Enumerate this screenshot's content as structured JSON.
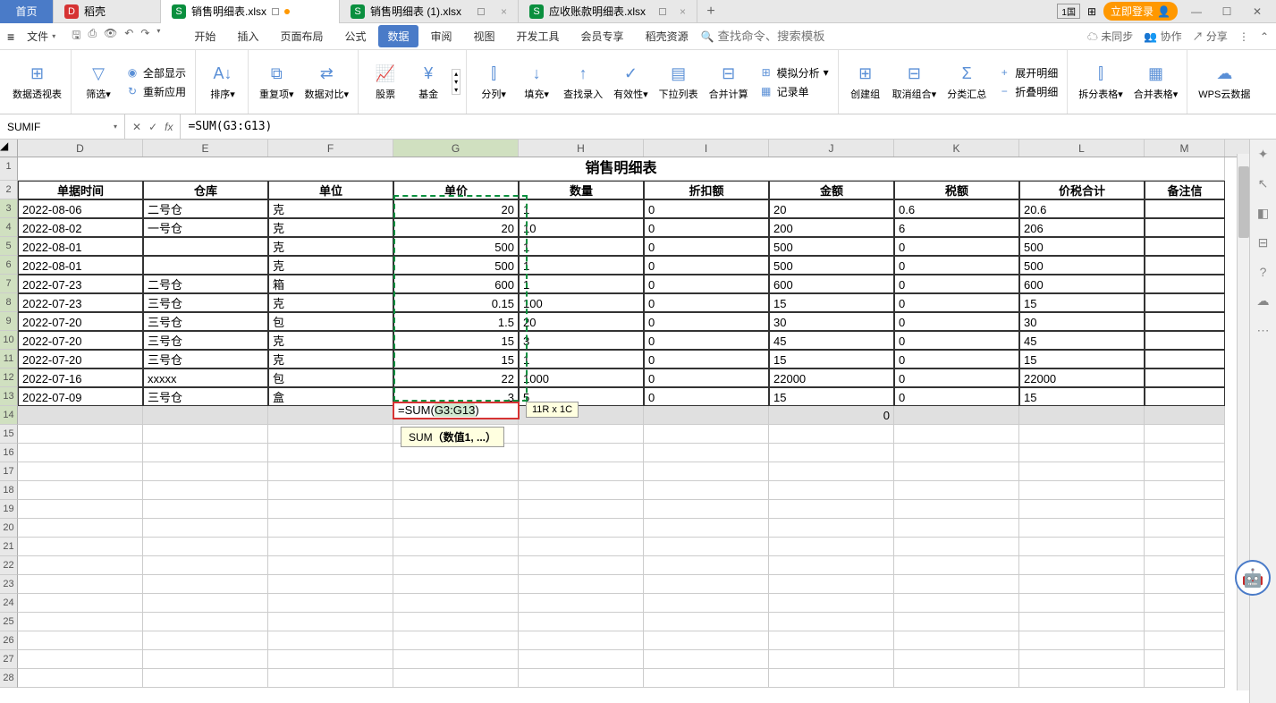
{
  "tabs": {
    "home": "首页",
    "docer": "稻壳",
    "active": "销售明细表.xlsx",
    "t2": "销售明细表 (1).xlsx",
    "t3": "应收账款明细表.xlsx"
  },
  "titlebar": {
    "login": "立即登录",
    "lang": "1国"
  },
  "menu": {
    "file": "文件",
    "items": [
      "开始",
      "插入",
      "页面布局",
      "公式",
      "数据",
      "审阅",
      "视图",
      "开发工具",
      "会员专享",
      "稻壳资源"
    ],
    "active_index": 4,
    "search_placeholder": "查找命令、搜索模板",
    "unsync": "未同步",
    "coop": "协作",
    "share": "分享"
  },
  "ribbon": {
    "pivot": "数据透视表",
    "filter": "筛选",
    "show_all": "全部显示",
    "reapply": "重新应用",
    "sort": "排序",
    "dup": "重复项",
    "compare": "数据对比",
    "stock": "股票",
    "fund": "基金",
    "split": "分列",
    "fill": "填充",
    "lookup": "查找录入",
    "valid": "有效性",
    "dropdown": "下拉列表",
    "consolidate": "合并计算",
    "whatif": "模拟分析",
    "form": "记录单",
    "group": "创建组",
    "ungroup": "取消组合",
    "subtotal": "分类汇总",
    "expand": "展开明细",
    "collapse": "折叠明细",
    "splittbl": "拆分表格",
    "mergetbl": "合并表格",
    "wps": "WPS云数据"
  },
  "formula_bar": {
    "name_box": "SUMIF",
    "formula": "=SUM(G3:G13)"
  },
  "sheet": {
    "title": "销售明细表",
    "headers": {
      "D": "单据时间",
      "E": "仓库",
      "F": "单位",
      "G": "单价",
      "H": "数量",
      "I": "折扣额",
      "J": "金额",
      "K": "税额",
      "L": "价税合计",
      "M": "备注信"
    },
    "rows": [
      {
        "D": "2022-08-06",
        "E": "二号仓",
        "F": "克",
        "G": "20",
        "H": "1",
        "I": "0",
        "J": "20",
        "K": "0.6",
        "L": "20.6"
      },
      {
        "D": "2022-08-02",
        "E": "一号仓",
        "F": "克",
        "G": "20",
        "H": "10",
        "I": "0",
        "J": "200",
        "K": "6",
        "L": "206"
      },
      {
        "D": "2022-08-01",
        "E": "",
        "F": "克",
        "G": "500",
        "H": "1",
        "I": "0",
        "J": "500",
        "K": "0",
        "L": "500"
      },
      {
        "D": "2022-08-01",
        "E": "",
        "F": "克",
        "G": "500",
        "H": "1",
        "I": "0",
        "J": "500",
        "K": "0",
        "L": "500"
      },
      {
        "D": "2022-07-23",
        "E": "二号仓",
        "F": "箱",
        "G": "600",
        "H": "1",
        "I": "0",
        "J": "600",
        "K": "0",
        "L": "600"
      },
      {
        "D": "2022-07-23",
        "E": "三号仓",
        "F": "克",
        "G": "0.15",
        "H": "100",
        "I": "0",
        "J": "15",
        "K": "0",
        "L": "15"
      },
      {
        "D": "2022-07-20",
        "E": "三号仓",
        "F": "包",
        "G": "1.5",
        "H": "20",
        "I": "0",
        "J": "30",
        "K": "0",
        "L": "30"
      },
      {
        "D": "2022-07-20",
        "E": "三号仓",
        "F": "克",
        "G": "15",
        "H": "3",
        "I": "0",
        "J": "45",
        "K": "0",
        "L": "45"
      },
      {
        "D": "2022-07-20",
        "E": "三号仓",
        "F": "克",
        "G": "15",
        "H": "1",
        "I": "0",
        "J": "15",
        "K": "0",
        "L": "15"
      },
      {
        "D": "2022-07-16",
        "E": "xxxxx",
        "F": "包",
        "G": "22",
        "H": "1000",
        "I": "0",
        "J": "22000",
        "K": "0",
        "L": "22000"
      },
      {
        "D": "2022-07-09",
        "E": "三号仓",
        "F": "盒",
        "G": "3",
        "H": "5",
        "I": "0",
        "J": "15",
        "K": "0",
        "L": "15"
      }
    ],
    "sum_row": {
      "J": "0"
    },
    "formula_display": "=SUM(",
    "formula_ref": "G3:G13",
    "formula_end": ")",
    "size_hint": "11R x 1C",
    "func_hint_name": "SUM",
    "func_hint_args": "（数值1, ...）"
  },
  "cols": [
    "D",
    "E",
    "F",
    "G",
    "H",
    "I",
    "J",
    "K",
    "L",
    "M"
  ]
}
